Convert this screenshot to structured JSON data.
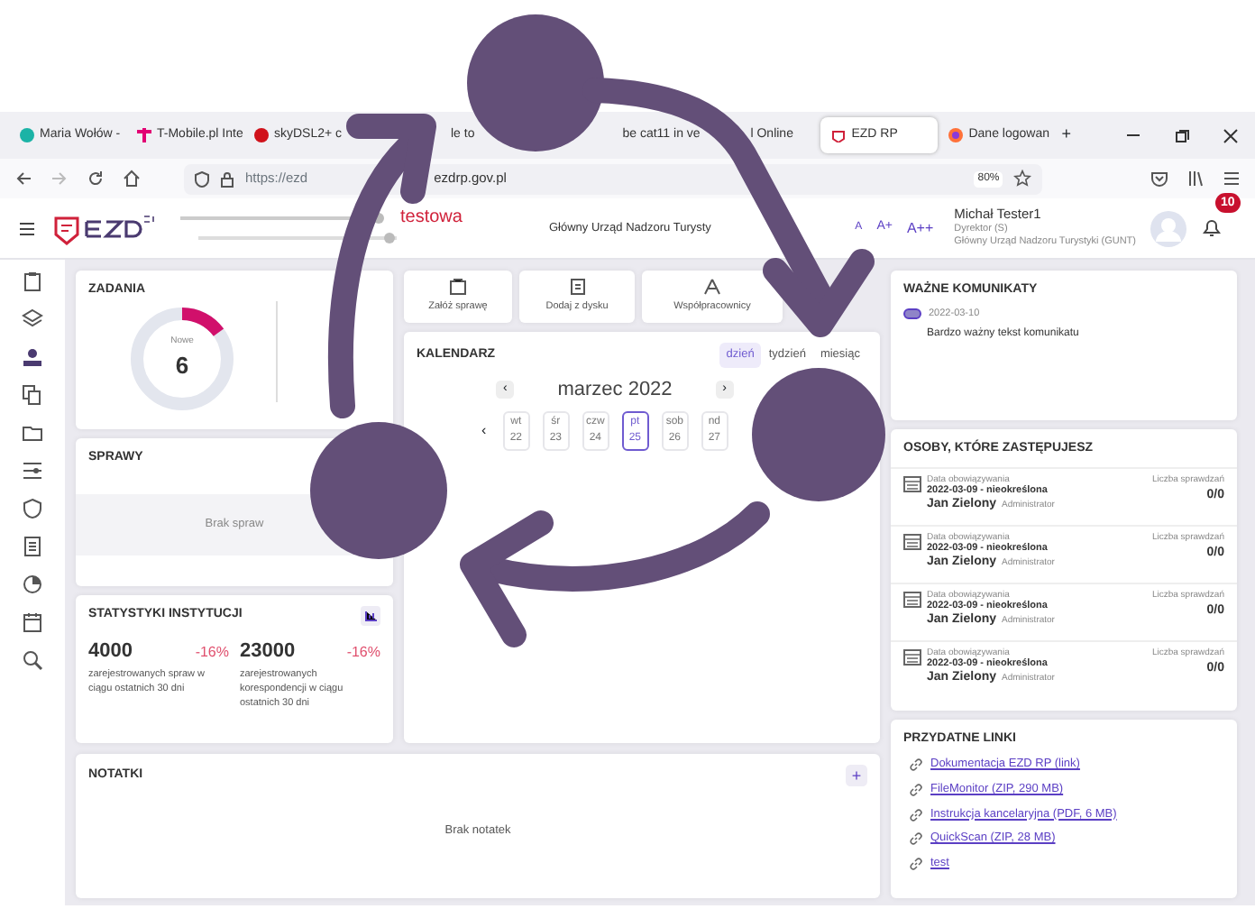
{
  "browser": {
    "tabs": [
      {
        "label": "Maria Wołów -",
        "selected": false
      },
      {
        "label": "T-Mobile.pl Inte",
        "selected": false
      },
      {
        "label": "skyDSL2+ c",
        "selected": false
      },
      {
        "label": "le to",
        "selected": false
      },
      {
        "label": "be cat11 in ve",
        "selected": false
      },
      {
        "label": "l Online",
        "selected": false
      },
      {
        "label": "EZD RP",
        "selected": true
      },
      {
        "label": "Dane logowan",
        "selected": false
      }
    ],
    "new_tab": "+",
    "url_start": "https://ezd",
    "url_end": "ezdrp.gov.pl",
    "zoom": "80%"
  },
  "header": {
    "version_label": "testowa",
    "office": "Główny Urząd Nadzoru Turysty",
    "font_sizes": [
      "A",
      "A+",
      "A++"
    ],
    "user": {
      "name": "Michał Tester1",
      "role": "Dyrektor (S)",
      "office": "Główny Urząd Nadzoru Turystyki (GUNT)"
    },
    "notifications": "10"
  },
  "zadania": {
    "title": "ZADANIA",
    "donut_label": "Nowe",
    "donut_value": "6",
    "level": 0.15
  },
  "sprawy": {
    "title": "SPRAWY",
    "empty": "Brak spraw"
  },
  "statystyki": {
    "title": "STATYSTYKI INSTYTUCJI",
    "items": [
      {
        "value": "4000",
        "change": "-16%",
        "caption": "zarejestrowanych spraw w ciągu ostatnich 30 dni"
      },
      {
        "value": "23000",
        "change": "-16%",
        "caption": "zarejestrowanych korespondencji w ciągu ostatnich 30 dni"
      }
    ]
  },
  "actions": [
    {
      "label": "Załóż sprawę"
    },
    {
      "label": "Dodaj z dysku"
    },
    {
      "label": "Współpracownicy"
    }
  ],
  "kalendarz": {
    "title": "KALENDARZ",
    "views": [
      {
        "label": "dzień",
        "selected": true
      },
      {
        "label": "tydzień",
        "selected": false
      },
      {
        "label": "miesiąc",
        "selected": false
      }
    ],
    "prev": "‹",
    "month": "marzec 2022",
    "next": "›",
    "days_prev": "‹",
    "days": [
      {
        "name": "wt",
        "num": "22",
        "selected": false
      },
      {
        "name": "śr",
        "num": "23",
        "selected": false
      },
      {
        "name": "czw",
        "num": "24",
        "selected": false
      },
      {
        "name": "pt",
        "num": "25",
        "selected": true
      },
      {
        "name": "sob",
        "num": "26",
        "selected": false
      },
      {
        "name": "nd",
        "num": "27",
        "selected": false
      }
    ]
  },
  "notatki": {
    "title": "NOTATKI",
    "add": "+",
    "empty": "Brak notatek"
  },
  "komunikaty": {
    "title": "WAŻNE KOMUNIKATY",
    "items": [
      {
        "date": "2022-03-10",
        "text": "Bardzo ważny tekst komunikatu"
      }
    ]
  },
  "osoby": {
    "title": "OSOBY, KTÓRE ZASTĘPUJESZ",
    "rows": [
      {
        "date_label": "Data obowiązywania",
        "dates": "2022-03-09 - nieokreślona",
        "name": "Jan Zielony",
        "role": "Administrator",
        "count_label": "Liczba sprawdzań",
        "count": "0/0"
      },
      {
        "date_label": "Data obowiązywania",
        "dates": "2022-03-09 - nieokreślona",
        "name": "Jan Zielony",
        "role": "Administrator",
        "count_label": "Liczba sprawdzań",
        "count": "0/0"
      },
      {
        "date_label": "Data obowiązywania",
        "dates": "2022-03-09 - nieokreślona",
        "name": "Jan Zielony",
        "role": "Administrator",
        "count_label": "Liczba sprawdzań",
        "count": "0/0"
      },
      {
        "date_label": "Data obowiązywania",
        "dates": "2022-03-09 - nieokreślona",
        "name": "Jan Zielony",
        "role": "Administrator",
        "count_label": "Liczba sprawdzań",
        "count": "0/0"
      }
    ]
  },
  "linki": {
    "title": "PRZYDATNE LINKI",
    "items": [
      "Dokumentacja EZD RP (link)",
      "FileMonitor (ZIP, 290 MB)",
      "Instrukcja kancelaryjna (PDF, 6 MB)",
      "QuickScan (ZIP, 28 MB)",
      "test"
    ]
  }
}
